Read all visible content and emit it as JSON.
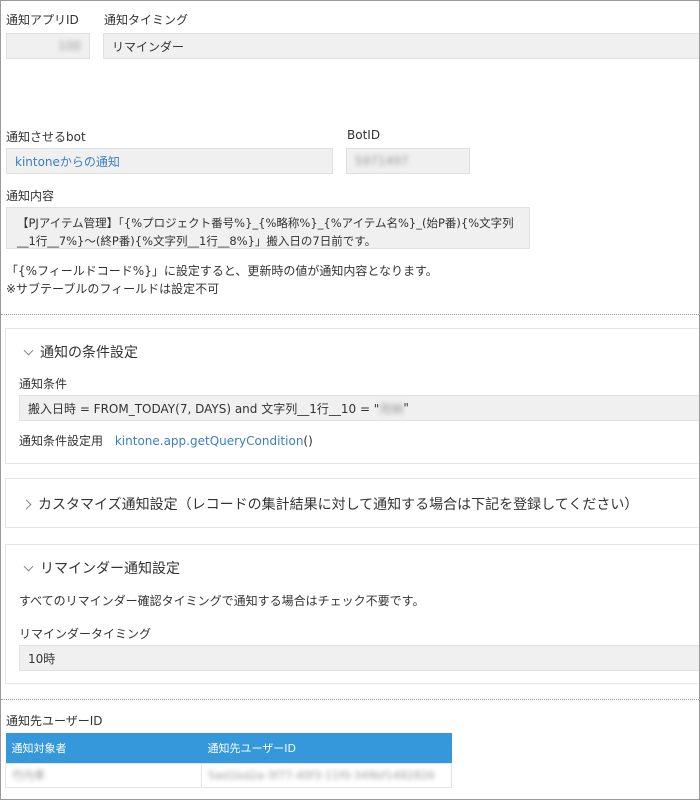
{
  "notify_app_id": {
    "label": "通知アプリID",
    "value": "100"
  },
  "timing": {
    "label": "通知タイミング",
    "value": "リマインダー"
  },
  "bot": {
    "label": "通知させるbot",
    "value": "kintoneからの通知"
  },
  "bot_id": {
    "label": "BotID",
    "value": "5971497"
  },
  "content": {
    "label": "通知内容",
    "value": "【PJアイテム管理】「{%プロジェクト番号%}_{%略称%}_{%アイテム名%}_(始P番){%文字列__1行__7%}〜(終P番){%文字列__1行__8%}」搬入日の7日前です。",
    "help_line1": "「{%フィールドコード%}」に設定すると、更新時の値が通知内容となります。",
    "help_line2": "※サブテーブルのフィールドは設定不可"
  },
  "conditions": {
    "title": "通知の条件設定",
    "label": "通知条件",
    "query_prefix": "搬入日時 = FROM_TODAY(7, DAYS) and 文字列__1行__10 = \"",
    "query_value": "完納",
    "query_suffix": "\"",
    "helper_label": "通知条件設定用",
    "helper_link": "kintone.app.getQueryCondition",
    "helper_parens": "()"
  },
  "custom": {
    "title": "カスタマイズ通知設定（レコードの集計結果に対して通知する場合は下記を登録してください）"
  },
  "reminder": {
    "title": "リマインダー通知設定",
    "description": "すべてのリマインダー確認タイミングで通知する場合はチェック不要です。",
    "timing_label": "リマインダータイミング",
    "timing_value": "10時"
  },
  "recipients": {
    "label": "通知先ユーザーID",
    "columns": [
      "通知対象者",
      "通知先ユーザーID"
    ],
    "rows": [
      {
        "name": "竹内孝",
        "user_id": "5ad1bd2a-3f77-40f3-11f0-349bf1482826"
      }
    ]
  },
  "colors": {
    "link": "#3a7fc0",
    "table_header": "#3498db"
  }
}
